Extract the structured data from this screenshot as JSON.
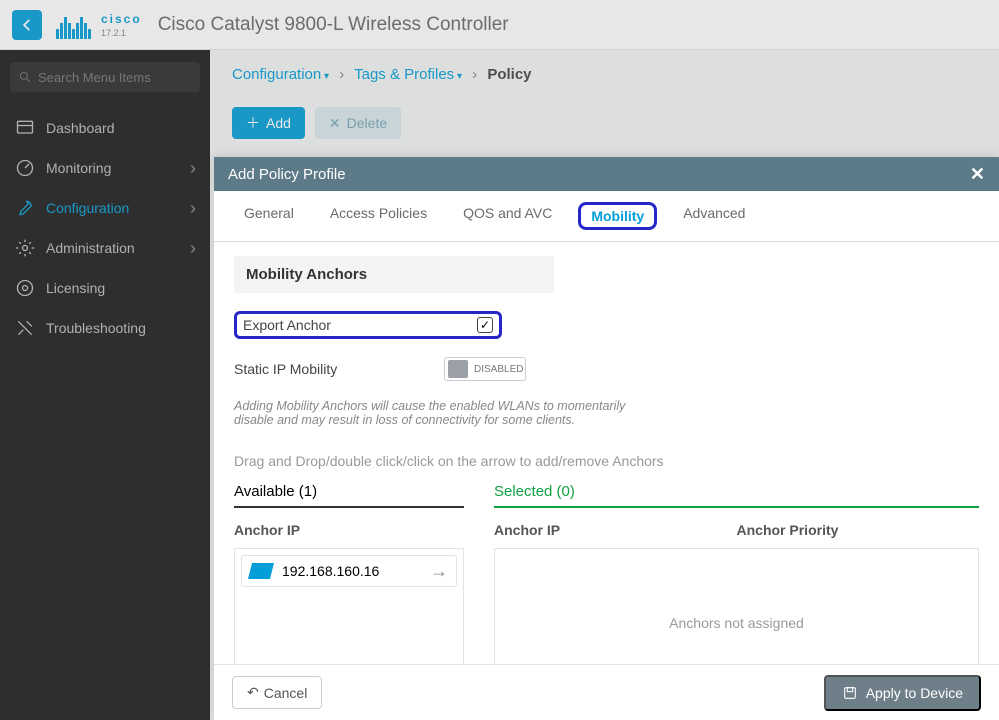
{
  "brand": {
    "word": "cisco",
    "version": "17.2.1"
  },
  "title": "Cisco Catalyst 9800-L Wireless Controller",
  "search_placeholder": "Search Menu Items",
  "nav": {
    "dashboard": "Dashboard",
    "monitoring": "Monitoring",
    "configuration": "Configuration",
    "administration": "Administration",
    "licensing": "Licensing",
    "troubleshooting": "Troubleshooting"
  },
  "breadcrumb": {
    "a": "Configuration",
    "b": "Tags & Profiles",
    "c": "Policy"
  },
  "actions": {
    "add": "Add",
    "delete": "Delete"
  },
  "modal": {
    "title": "Add Policy Profile",
    "tabs": {
      "general": "General",
      "access": "Access Policies",
      "qos": "QOS and AVC",
      "mobility": "Mobility",
      "advanced": "Advanced"
    },
    "mobility": {
      "section": "Mobility Anchors",
      "export_label": "Export Anchor",
      "static_label": "Static IP Mobility",
      "static_state": "DISABLED",
      "note": "Adding Mobility Anchors will cause the enabled WLANs to momentarily disable and may result in loss of connectivity for some clients.",
      "hint": "Drag and Drop/double click/click on the arrow to add/remove Anchors",
      "available_title": "Available (1)",
      "selected_title": "Selected (0)",
      "col_anchor_ip": "Anchor IP",
      "col_anchor_priority": "Anchor Priority",
      "available_items": [
        "192.168.160.16"
      ],
      "selected_empty": "Anchors not assigned"
    },
    "footer": {
      "cancel": "Cancel",
      "apply": "Apply to Device"
    }
  }
}
